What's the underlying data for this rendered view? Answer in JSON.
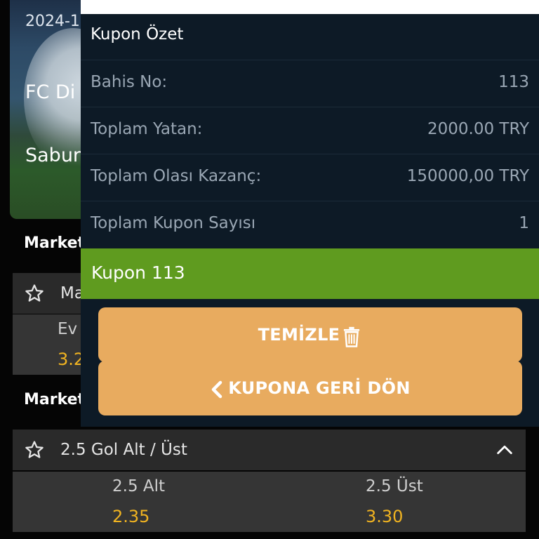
{
  "background": {
    "event": {
      "date": "2024-1",
      "team_home": "FC Di",
      "team_away": "Sabur"
    },
    "markets": [
      {
        "section_title": "Market",
        "name": "Ma",
        "odds": [
          {
            "label": "Ev",
            "value": "3.2"
          }
        ]
      },
      {
        "section_title": "Market",
        "name": "2.5 Gol Alt / Üst",
        "odds": [
          {
            "label": "2.5 Alt",
            "value": "2.35"
          },
          {
            "label": "2.5 Üst",
            "value": "3.30"
          }
        ]
      }
    ]
  },
  "coupon_summary": {
    "title": "Kupon Özet",
    "rows": [
      {
        "label": "Bahis No:",
        "value": "113"
      },
      {
        "label": "Toplam Yatan:",
        "value": "2000.00 TRY"
      },
      {
        "label": "Toplam Olası Kazanç:",
        "value": "150000,00 TRY"
      },
      {
        "label": "Toplam Kupon Sayısı",
        "value": "1"
      }
    ],
    "coupon_bar_label": "Kupon 113",
    "clear_button_label": "TEMİZLE",
    "back_button_label": "KUPONA GERİ DÖN"
  },
  "colors": {
    "modal_bg": "#0d1a26",
    "coupon_bar": "#5f9b1f",
    "button_bg": "#e8ab5f",
    "odds_value": "#f0b321"
  },
  "icons": {
    "favorite": "star-outline-icon",
    "collapse": "chevron-up-icon",
    "clear": "trash-icon",
    "back": "chevron-left-icon"
  }
}
